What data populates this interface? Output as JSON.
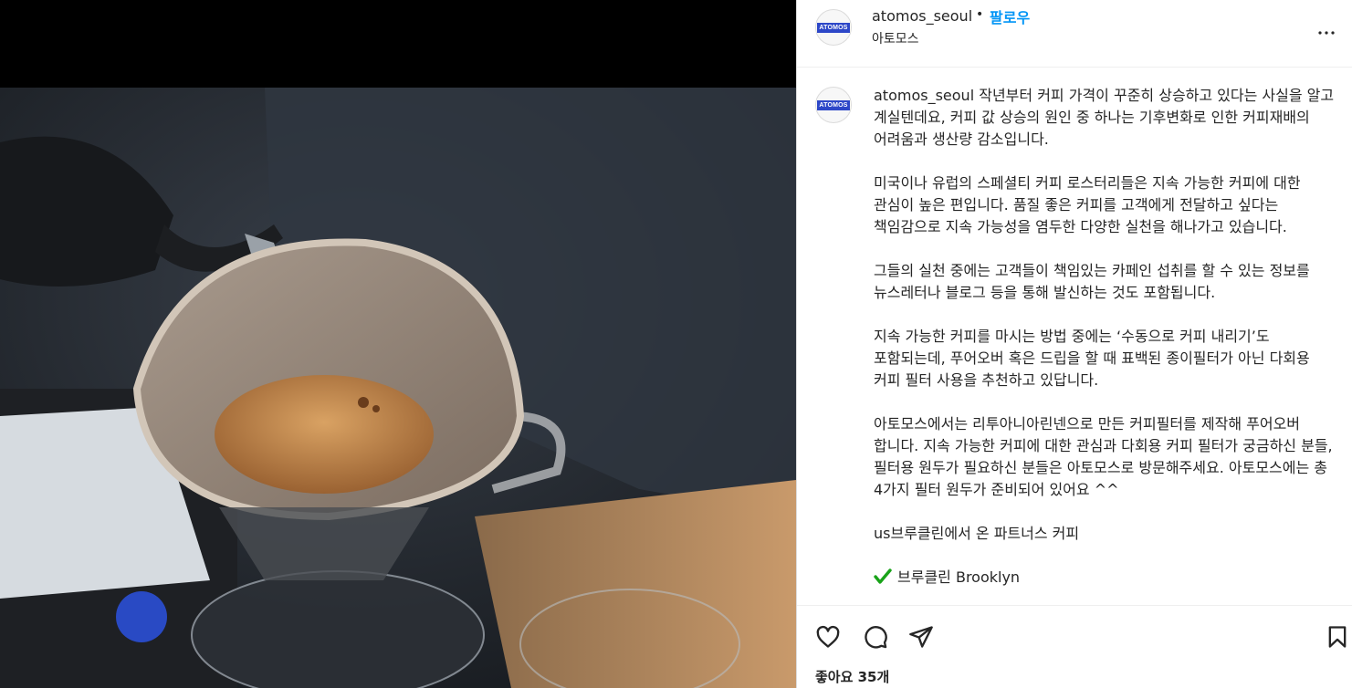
{
  "header": {
    "username": "atomos_seoul",
    "separator": "•",
    "follow_label": "팔로우",
    "subtitle": "아토모스",
    "avatar_logo_text": "ATOMOS"
  },
  "caption": {
    "username": "atomos_seoul",
    "body": "작년부터 커피 가격이 꾸준히 상승하고 있다는 사실을 알고 계실텐데요, 커피 값 상승의 원인 중 하나는 기후변화로 인한 커피재배의 어려움과 생산량 감소입니다.\n\n미국이나 유럽의 스페셜티 커피 로스터리들은 지속 가능한 커피에 대한 관심이 높은 편입니다. 품질 좋은 커피를 고객에게 전달하고 싶다는 책임감으로 지속 가능성을 염두한 다양한 실천을 해나가고 있습니다.\n\n그들의 실천 중에는 고객들이 책임있는 카페인 섭취를 할 수 있는 정보를 뉴스레터나 블로그 등을 통해 발신하는 것도 포함됩니다.\n\n지속 가능한 커피를 마시는 방법 중에는 ‘수동으로 커피 내리기’도 포함되는데, 푸어오버 혹은 드립을 할 때 표백된 종이필터가 아닌 다회용 커피 필터 사용을 추천하고 있답니다.\n\n아토모스에서는 리투아니아린넨으로 만든 커피필터를 제작해 푸어오버 합니다. 지속 가능한 커피에 대한 관심과 다회용 커피 필터가 궁금하신 분들, 필터용 원두가 필요하신 분들은 아토모스로 방문해주세요. 아토모스에는 총 4가지 필터 원두가 준비되어 있어요 ^^\n\nus브루클린에서 온 파트너스 커피\n\n",
    "last_line": "브루클린 Brooklyn"
  },
  "actions": {
    "like_icon": "heart-icon",
    "comment_icon": "comment-icon",
    "share_icon": "share-icon",
    "save_icon": "bookmark-icon"
  },
  "likes": {
    "label": "좋아요 35개"
  },
  "colors": {
    "follow": "#0095f6",
    "check": "#19a319",
    "text": "#262626"
  }
}
